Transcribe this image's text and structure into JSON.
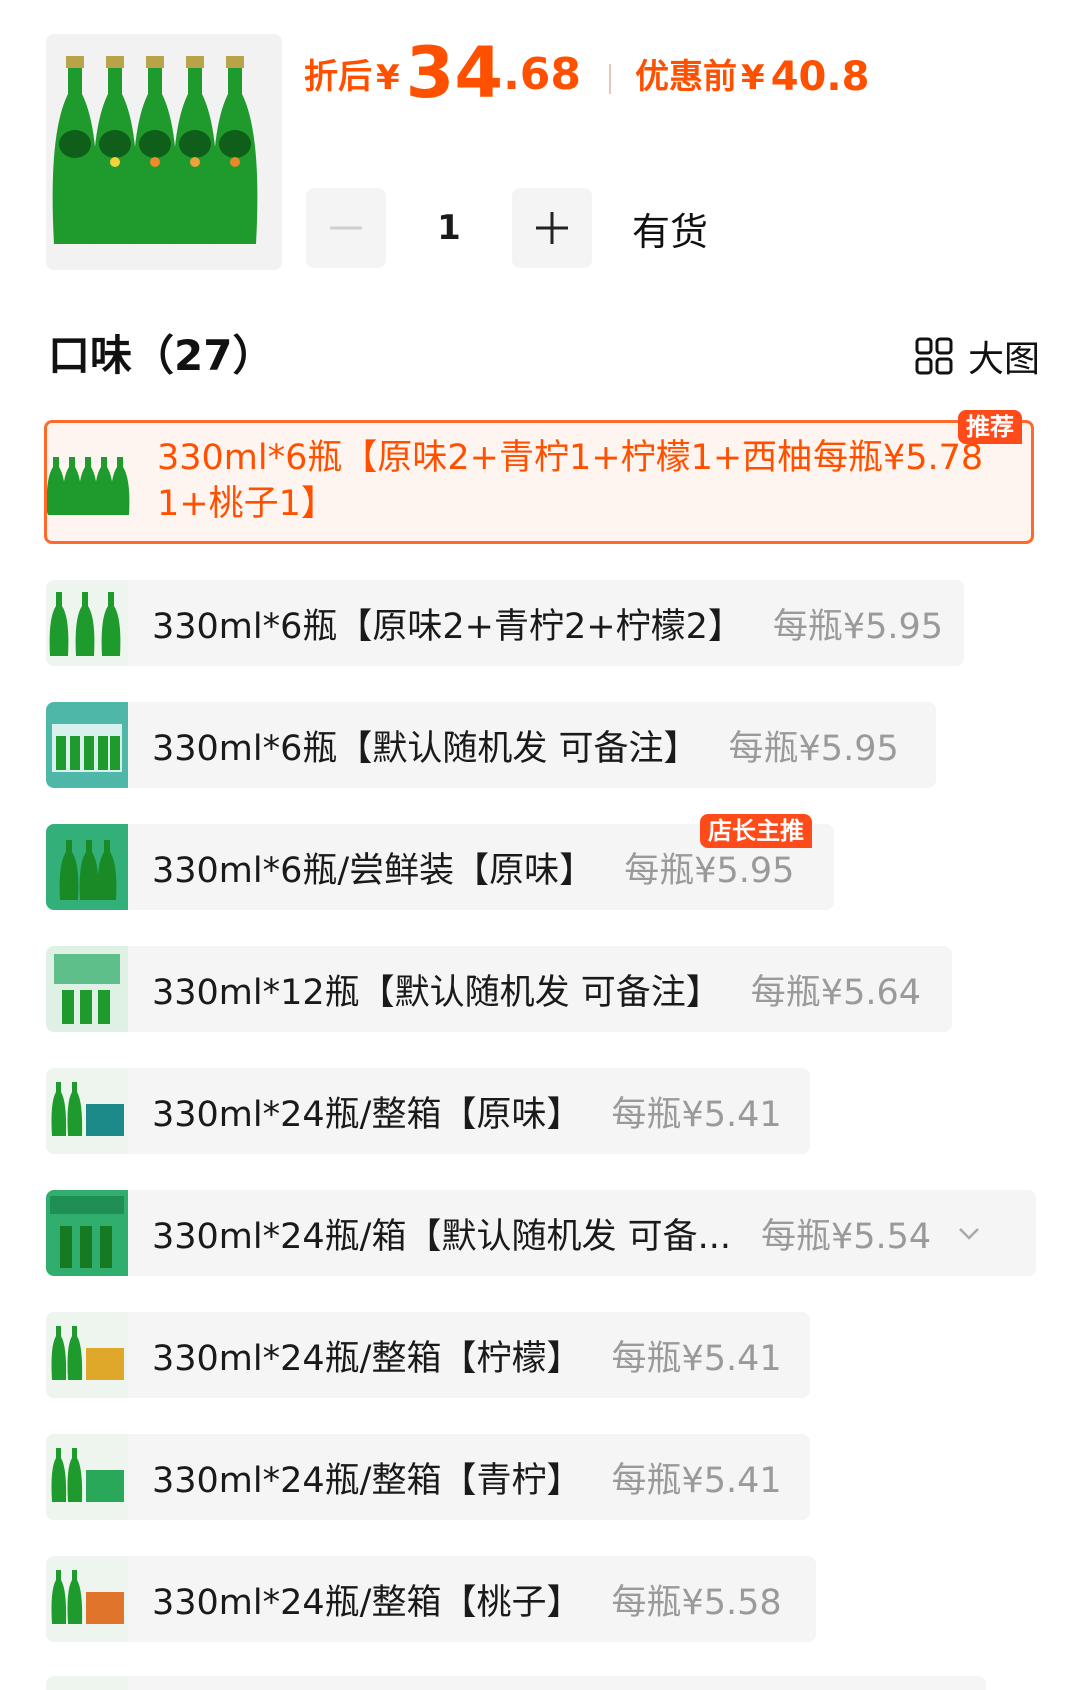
{
  "product": {
    "image_icon": "perrier-bottles-image",
    "price_label": "折后",
    "currency": "¥",
    "price_int": "34",
    "price_dec": ".68",
    "orig_label": "优惠前",
    "orig_currency": "¥",
    "orig_price": "40.8",
    "accent_color": "#ff5000"
  },
  "quantity": {
    "minus_icon": "minus-icon",
    "value": "1",
    "plus_icon": "plus-icon",
    "stock_label": "有货"
  },
  "flavor_section": {
    "title": "口味（27）",
    "view_label": "大图",
    "view_icon": "grid-icon"
  },
  "variants": [
    {
      "name": "330ml*6瓶【原味2+青柠1+柠檬1+西柚1+桃子1】",
      "price": "每瓶¥5.78",
      "badge": "推荐",
      "selected": true
    },
    {
      "name": "330ml*6瓶【原味2+青柠2+柠檬2】",
      "price": "每瓶¥5.95"
    },
    {
      "name": "330ml*6瓶【默认随机发 可备注】",
      "price": "每瓶¥5.95"
    },
    {
      "name": "330ml*6瓶/尝鲜装【原味】",
      "price": "每瓶¥5.95",
      "badge": "店长主推"
    },
    {
      "name": "330ml*12瓶【默认随机发 可备注】",
      "price": "每瓶¥5.64"
    },
    {
      "name": "330ml*24瓶/整箱【原味】",
      "price": "每瓶¥5.41"
    },
    {
      "name": "330ml*24瓶/箱【默认随机发 可备...",
      "price": "每瓶¥5.54",
      "expand_icon": "chevron-down-icon"
    },
    {
      "name": "330ml*24瓶/整箱【柠檬】",
      "price": "每瓶¥5.41"
    },
    {
      "name": "330ml*24瓶/整箱【青柠】",
      "price": "每瓶¥5.41"
    },
    {
      "name": "330ml*24瓶/整箱【桃子】",
      "price": "每瓶¥5.58"
    }
  ]
}
